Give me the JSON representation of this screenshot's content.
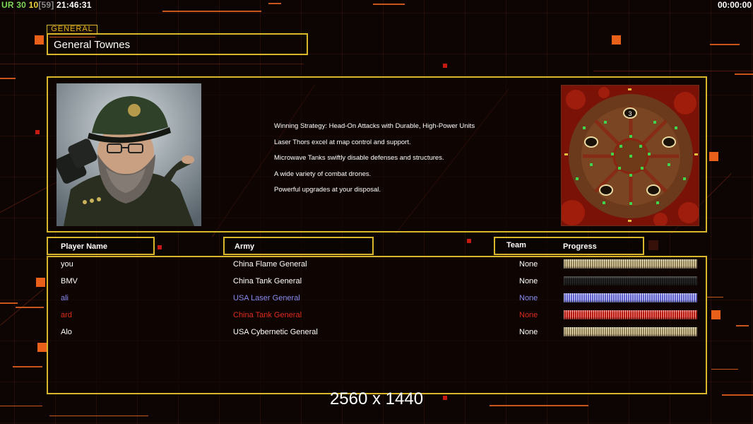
{
  "hud": {
    "ur_label": "UR",
    "stat_a": "30",
    "stat_b": "10",
    "stat_c": "[59]",
    "clock": "21:46:31",
    "timer": "00:00:00"
  },
  "general": {
    "tag": "GENERAL",
    "name": "General Townes",
    "strategy": [
      "Winning Strategy: Head-On Attacks with Durable, High-Power Units",
      "Laser Thors excel at map control and support.",
      "Microwave Tanks swiftly disable defenses and structures.",
      "A wide variety of combat drones.",
      "Powerful upgrades at your disposal."
    ],
    "map_marker": "3"
  },
  "table": {
    "headers": {
      "player": "Player Name",
      "army": "Army",
      "team": "Team",
      "progress": "Progress"
    },
    "rows": [
      {
        "name": "you",
        "army": "China Flame General",
        "team": "None",
        "color": "#ffffff",
        "bar": "gold"
      },
      {
        "name": "BMV",
        "army": "China Tank General",
        "team": "None",
        "color": "#ffffff",
        "bar": "dark"
      },
      {
        "name": "ali",
        "army": "USA Laser General",
        "team": "None",
        "color": "#8a8cf0",
        "bar": "blue"
      },
      {
        "name": "ard",
        "army": "China Tank General",
        "team": "None",
        "color": "#e02a1c",
        "bar": "red"
      },
      {
        "name": "Alo",
        "army": "USA Cybernetic General",
        "team": "None",
        "color": "#ffffff",
        "bar": "gold"
      }
    ]
  },
  "resolution_text": "2560 x 1440",
  "colors": {
    "frame": "#d9b62a",
    "accent_orange": "#e8601a",
    "accent_red": "#c51a12"
  }
}
